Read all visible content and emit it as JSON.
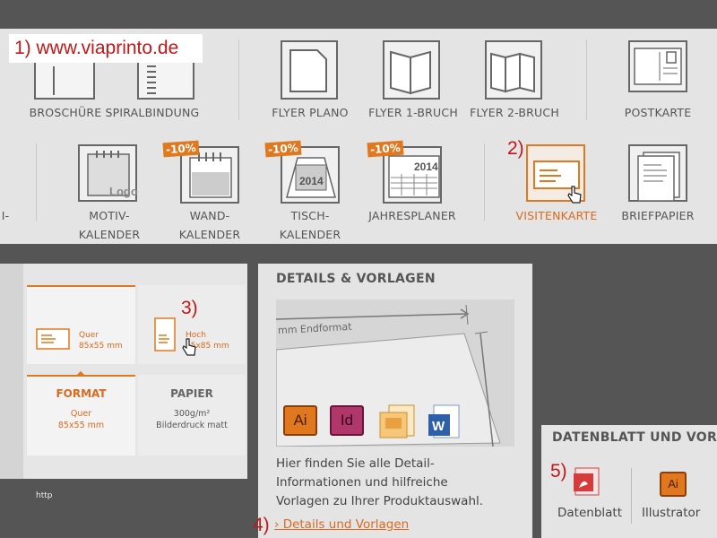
{
  "steps": {
    "s1": "1) www.viaprinto.de",
    "s2": "2)",
    "s3": "3)",
    "s4": "4)",
    "s5": "5)"
  },
  "products_row1": {
    "broschuere": "BROSCHÜRE",
    "spiralbindung": "SPIRALBINDUNG",
    "flyer_plano": "FLYER PLANO",
    "flyer_1": "FLYER 1-BRUCH",
    "flyer_2": "FLYER 2-BRUCH",
    "postkarte": "POSTKARTE"
  },
  "products_row2": {
    "left_fragment": "I-",
    "motiv_1": "MOTIV-",
    "motiv_2": "KALENDER",
    "wand_1": "WAND-",
    "wand_2": "KALENDER",
    "tisch_1": "TISCH-",
    "tisch_2": "KALENDER",
    "jahresplaner": "JAHRESPLANER",
    "visitenkarte": "VISITENKARTE",
    "briefpapier": "BRIEFPAPIER",
    "badge": "-10%",
    "year": "2014",
    "logo": "Logo"
  },
  "config": {
    "quer": "Quer",
    "quer_size": "85x55 mm",
    "hoch": "Hoch",
    "hoch_size": "55x85 mm",
    "format_label": "FORMAT",
    "format_v1": "Quer",
    "format_v2": "85x55 mm",
    "papier_label": "PAPIER",
    "papier_v1": "300g/m²",
    "papier_v2": "Bilderdruck matt",
    "http": "http"
  },
  "details": {
    "title": "DETAILS & VORLAGEN",
    "endformat": "mm Endformat",
    "text1": "Hier finden Sie alle Detail-",
    "text2": "Informationen und hilfreiche",
    "text3": "Vorlagen zu Ihrer Produktauswahl.",
    "link": "› Details und Vorlagen",
    "icon_ai": "Ai",
    "icon_id": "Id"
  },
  "datenblatt": {
    "title": "DATENBLATT UND VOR",
    "datenblatt": "Datenblatt",
    "illustrator": "Illustrator",
    "icon_ai": "Ai"
  },
  "colors": {
    "accent": "#e0781f",
    "step_red": "#c01818"
  }
}
